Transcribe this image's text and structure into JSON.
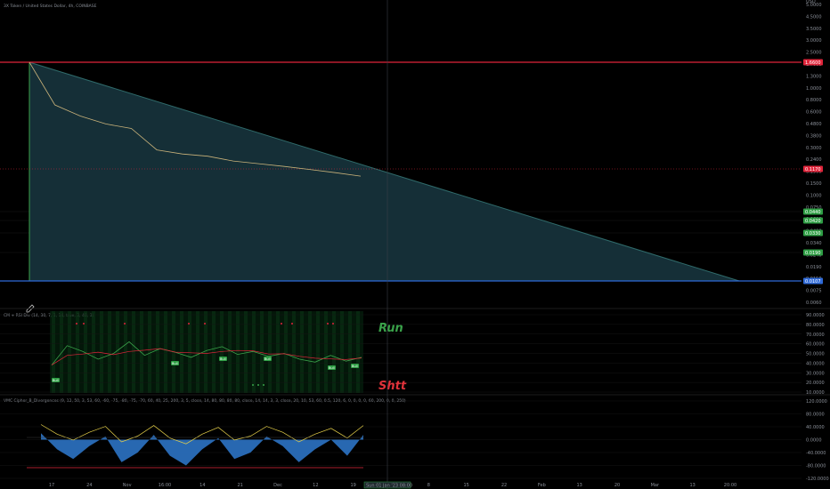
{
  "header": {
    "symbol": "3X Token / United States Dollar, 4h, COINBASE"
  },
  "colors": {
    "background": "#000000",
    "wedge_fill": "#16323a",
    "wedge_edge": "#2f6a6a",
    "resistance_line": "#e0243a",
    "support_line": "#2f6ad8",
    "price_line": "#c9b27a",
    "run": "#3aa24a",
    "shtt": "#e0323a",
    "green_tag": "#2e9e44",
    "red_tag": "#e0243a",
    "blue_tag": "#2f6ad8",
    "oscillator_blue": "#2f7ad0",
    "oscillator_yellow": "#e8d24a"
  },
  "price_axis": {
    "currency": "USD",
    "ticks": [
      "5.0000",
      "4.5000",
      "3.5000",
      "3.0000",
      "2.5000",
      "1.7000",
      "1.3000",
      "1.0000",
      "0.8000",
      "0.6000",
      "0.4800",
      "0.3800",
      "0.3000",
      "0.2400",
      "0.1900",
      "0.1500",
      "0.1000",
      "0.0750",
      "0.0600",
      "0.0480",
      "0.0340",
      "0.0240",
      "0.0190",
      "0.0150",
      "0.0075",
      "0.0060"
    ],
    "tags": [
      {
        "label": "1.6600",
        "kind": "red"
      },
      {
        "label": "0.1170",
        "kind": "red"
      },
      {
        "label": "0.0440",
        "kind": "green"
      },
      {
        "label": "0.0420",
        "kind": "green"
      },
      {
        "label": "0.0330",
        "kind": "green"
      },
      {
        "label": "0.0190",
        "kind": "green"
      },
      {
        "label": "0.0107",
        "kind": "blue"
      }
    ]
  },
  "rsi_pane": {
    "title": "CM + RSI Div (14, 30, 7, 1, 14, true, 3, 40, 3)",
    "axis_ticks": [
      "90.0000",
      "80.0000",
      "70.0000",
      "60.0000",
      "50.0000",
      "40.0000",
      "30.0000",
      "20.0000",
      "10.0000"
    ],
    "run_label": "Run",
    "shtt_label": "Shtt",
    "markers": [
      "Bull",
      "Bull",
      "Bull",
      "Bull",
      "Bull",
      "Bull"
    ]
  },
  "oscillator_pane": {
    "title": "VMC Cipher_B_Divergences (9, 12, 50, 3, 53, 60, -60, -75, -80, -75, -70, 60, 40, 25, 200, 3, 5, close, 14, 80, 80, 80, 80, close, 14, 14, 3, 3, close, 20, 10, 53, 60, 0.5, 120, 6, 0, 0, 0, 0, 60, 200, 0, 0, 250)",
    "axis_ticks": [
      "120.0000",
      "80.0000",
      "40.0000",
      "0.0000",
      "-40.0000",
      "-80.0000",
      "-120.0000"
    ]
  },
  "time_axis": {
    "labels": [
      "17",
      "24",
      "Nov",
      "16:00",
      "14",
      "21",
      "Dec",
      "12",
      "19",
      "26",
      "8",
      "15",
      "22",
      "Feb",
      "13",
      "20",
      "Mar",
      "13",
      "20:00"
    ],
    "cursor_label": "Sun 01 Jan '23  08:00"
  },
  "chart_data": {
    "type": "line",
    "title": "3X Token / United States Dollar, 4h, COINBASE",
    "y_scale": "log",
    "y_unit": "USD",
    "x": [
      "17",
      "24",
      "Nov",
      "16:00",
      "14",
      "21",
      "Dec",
      "12",
      "19",
      "26"
    ],
    "series": [
      {
        "values": [
          1.66,
          0.62,
          0.48,
          0.4,
          0.36,
          0.22,
          0.2,
          0.19,
          0.17,
          0.16,
          0.15,
          0.14,
          0.13,
          0.12
        ]
      }
    ],
    "horizontal_levels": [
      {
        "value": 1.66,
        "color": "red"
      },
      {
        "value": 0.0107,
        "color": "blue"
      }
    ],
    "rsi": {
      "ylim": [
        10,
        90
      ],
      "values": [
        38,
        58,
        52,
        44,
        50,
        62,
        48,
        55,
        51,
        46,
        53,
        57,
        49,
        52,
        47,
        50,
        44,
        41,
        48,
        42,
        46
      ]
    },
    "oscillator": {
      "ylim": [
        -120,
        120
      ],
      "values": [
        20,
        -30,
        -60,
        -20,
        10,
        -70,
        -40,
        15,
        -50,
        -80,
        -30,
        5,
        -60,
        -40,
        10,
        -20,
        -70,
        -30,
        0,
        -50,
        15
      ]
    }
  }
}
